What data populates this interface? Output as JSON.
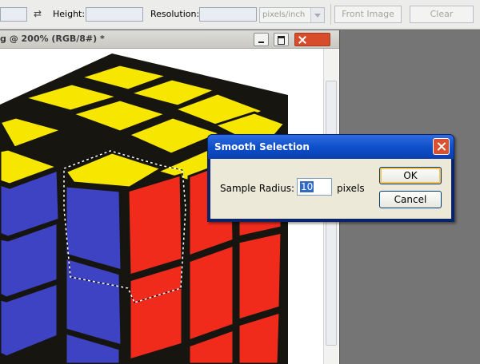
{
  "options_bar": {
    "height_label": "Height:",
    "resolution_label": "Resolution:",
    "unit_select": "pixels/inch",
    "front_image_button": "Front Image",
    "clear_button": "Clear"
  },
  "document": {
    "title": "g @ 200% (RGB/8#) *"
  },
  "dialog": {
    "title": "Smooth Selection",
    "sample_radius_label": "Sample Radius:",
    "sample_radius_value": "10",
    "unit": "pixels",
    "ok_button": "OK",
    "cancel_button": "Cancel"
  },
  "colors": {
    "cube_yellow": "#f7e600",
    "cube_blue": "#3e43c4",
    "cube_red": "#f02b1c",
    "cube_black": "#161510",
    "titlebar_blue": "#0c4ec9"
  }
}
